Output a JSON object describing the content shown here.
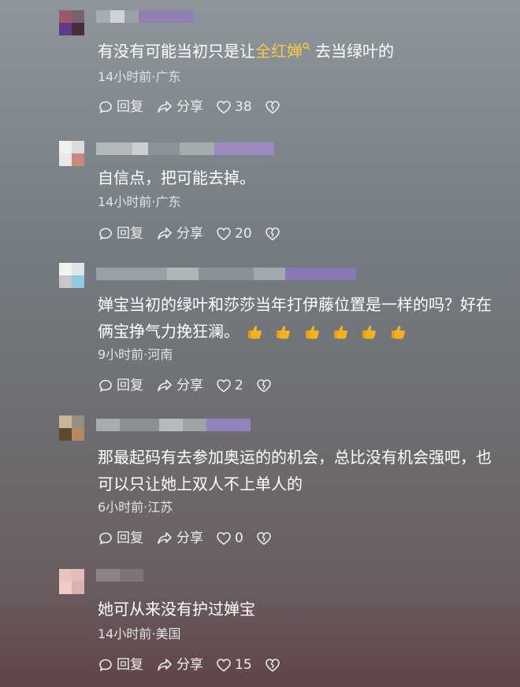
{
  "comments": [
    {
      "text_before": "有没有可能当初只是让",
      "highlight": "全红婵",
      "text_after": "去当绿叶的",
      "meta": "14小时前·广东",
      "reply_label": "回复",
      "share_label": "分享",
      "likes": "38"
    },
    {
      "text": "自信点，把可能去掉。",
      "meta": "14小时前·广东",
      "reply_label": "回复",
      "share_label": "分享",
      "likes": "20"
    },
    {
      "text_line1": "婵宝当初的绿叶和莎莎当年打伊藤位置是一样的吗？好在",
      "text_line2": "俩宝挣气力挽狂澜。",
      "emoji_count": 6,
      "meta": "9小时前·河南",
      "reply_label": "回复",
      "share_label": "分享",
      "likes": "2"
    },
    {
      "text_line1": "那最起码有去参加奥运的的机会，总比没有机会强吧，也",
      "text_line2": "可以只让她上双人不上单人的",
      "meta": "6小时前·江苏",
      "reply_label": "回复",
      "share_label": "分享",
      "likes": "0"
    },
    {
      "text": "她可从来没有护过婵宝",
      "meta": "14小时前·美国",
      "reply_label": "回复",
      "share_label": "分享",
      "likes": "15"
    }
  ],
  "colors": {
    "highlight": "#f7c846",
    "meta": "#e1e4e6",
    "thumb": "#f6b21c"
  }
}
